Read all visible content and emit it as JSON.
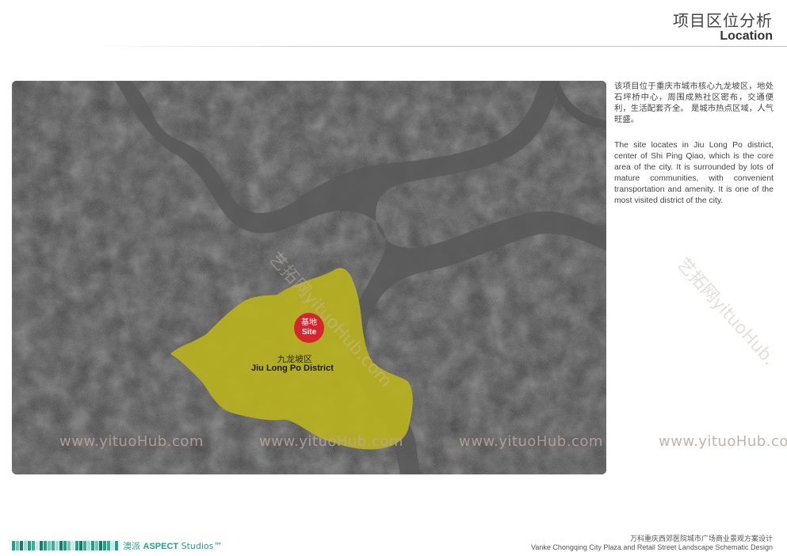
{
  "header": {
    "title_cn": "项目区位分析",
    "title_en": "Location"
  },
  "map": {
    "site_label_cn": "基地",
    "site_label_en": "Site",
    "district_cn": "九龙坡区",
    "district_en": "Jiu Long Po District",
    "colors": {
      "district_fill": "#b8b21e",
      "site_marker": "#d7252f",
      "river": "#5c5c5c"
    }
  },
  "description": {
    "cn": "该项目位于重庆市城市核心九龙坡区，地处石坪桥中心，周围成熟社区密布，交通便利，生活配套齐全。 是城市热点区域，人气旺盛。",
    "en": "The site locates in Jiu Long Po district, center of Shi Ping Qiao, which is the core area of the city. It is surrounded by lots of mature communities, with convenient transportation and amenity.  It is one of the most visited district of the city."
  },
  "watermarks": {
    "bottom": [
      "www.yituoHub.com",
      "www.yituoHub.com",
      "www.yituoHub.com",
      "www.yituoHub.co"
    ],
    "diagonal": [
      "艺拓网yituoHub.com",
      "艺拓网yituoHub."
    ]
  },
  "footer": {
    "logo_cn": "澳派",
    "logo_en": "ASPECT",
    "logo_suffix": "Studios™",
    "project_cn": "万科重庆西郊医院城市广场商业景观方案设计",
    "project_en": "Vanke Chongqing City Plaza and Retail Street Landscape Schematic Design"
  }
}
